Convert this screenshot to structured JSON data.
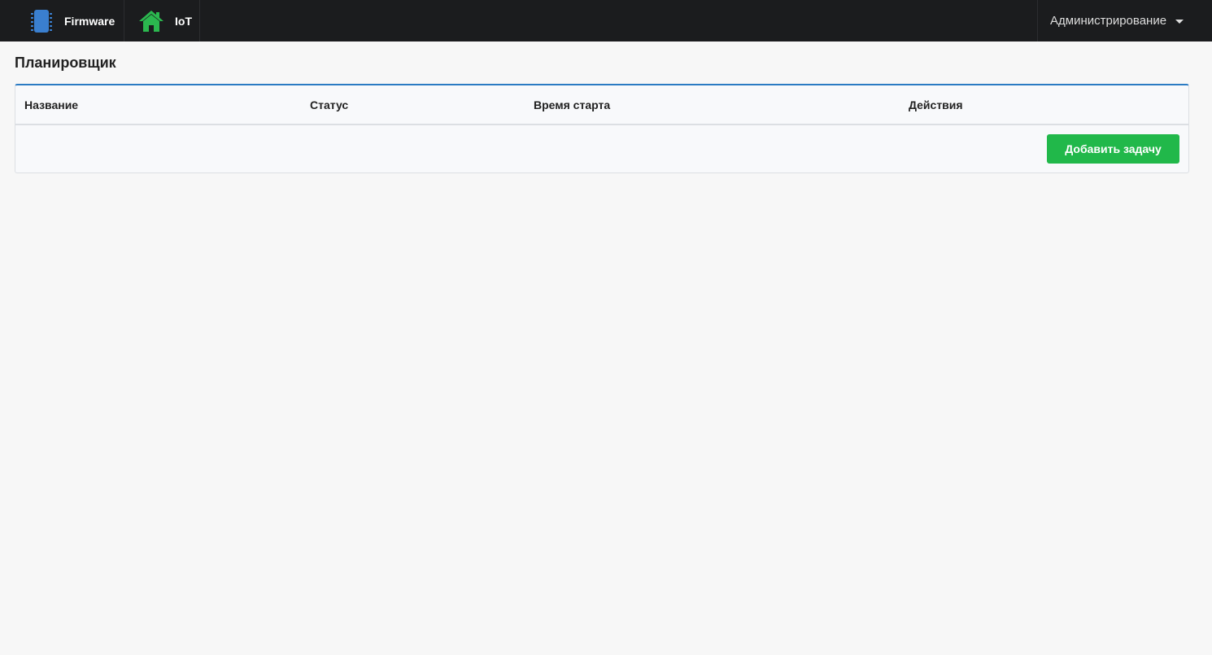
{
  "navbar": {
    "brand_label": "Firmware",
    "iot_label": "IoT",
    "admin_label": "Администрирование",
    "icons": {
      "firmware": "chip-icon",
      "iot": "home-icon"
    },
    "colors": {
      "background": "#1b1c1e",
      "chip": "#3a7fcf",
      "home": "#2bb84f"
    }
  },
  "page": {
    "title": "Планировщик"
  },
  "table": {
    "columns": [
      "Название",
      "Статус",
      "Время старта",
      "Действия"
    ],
    "rows": []
  },
  "actions": {
    "add_task_label": "Добавить задачу",
    "add_task_color": "#21b84a"
  }
}
